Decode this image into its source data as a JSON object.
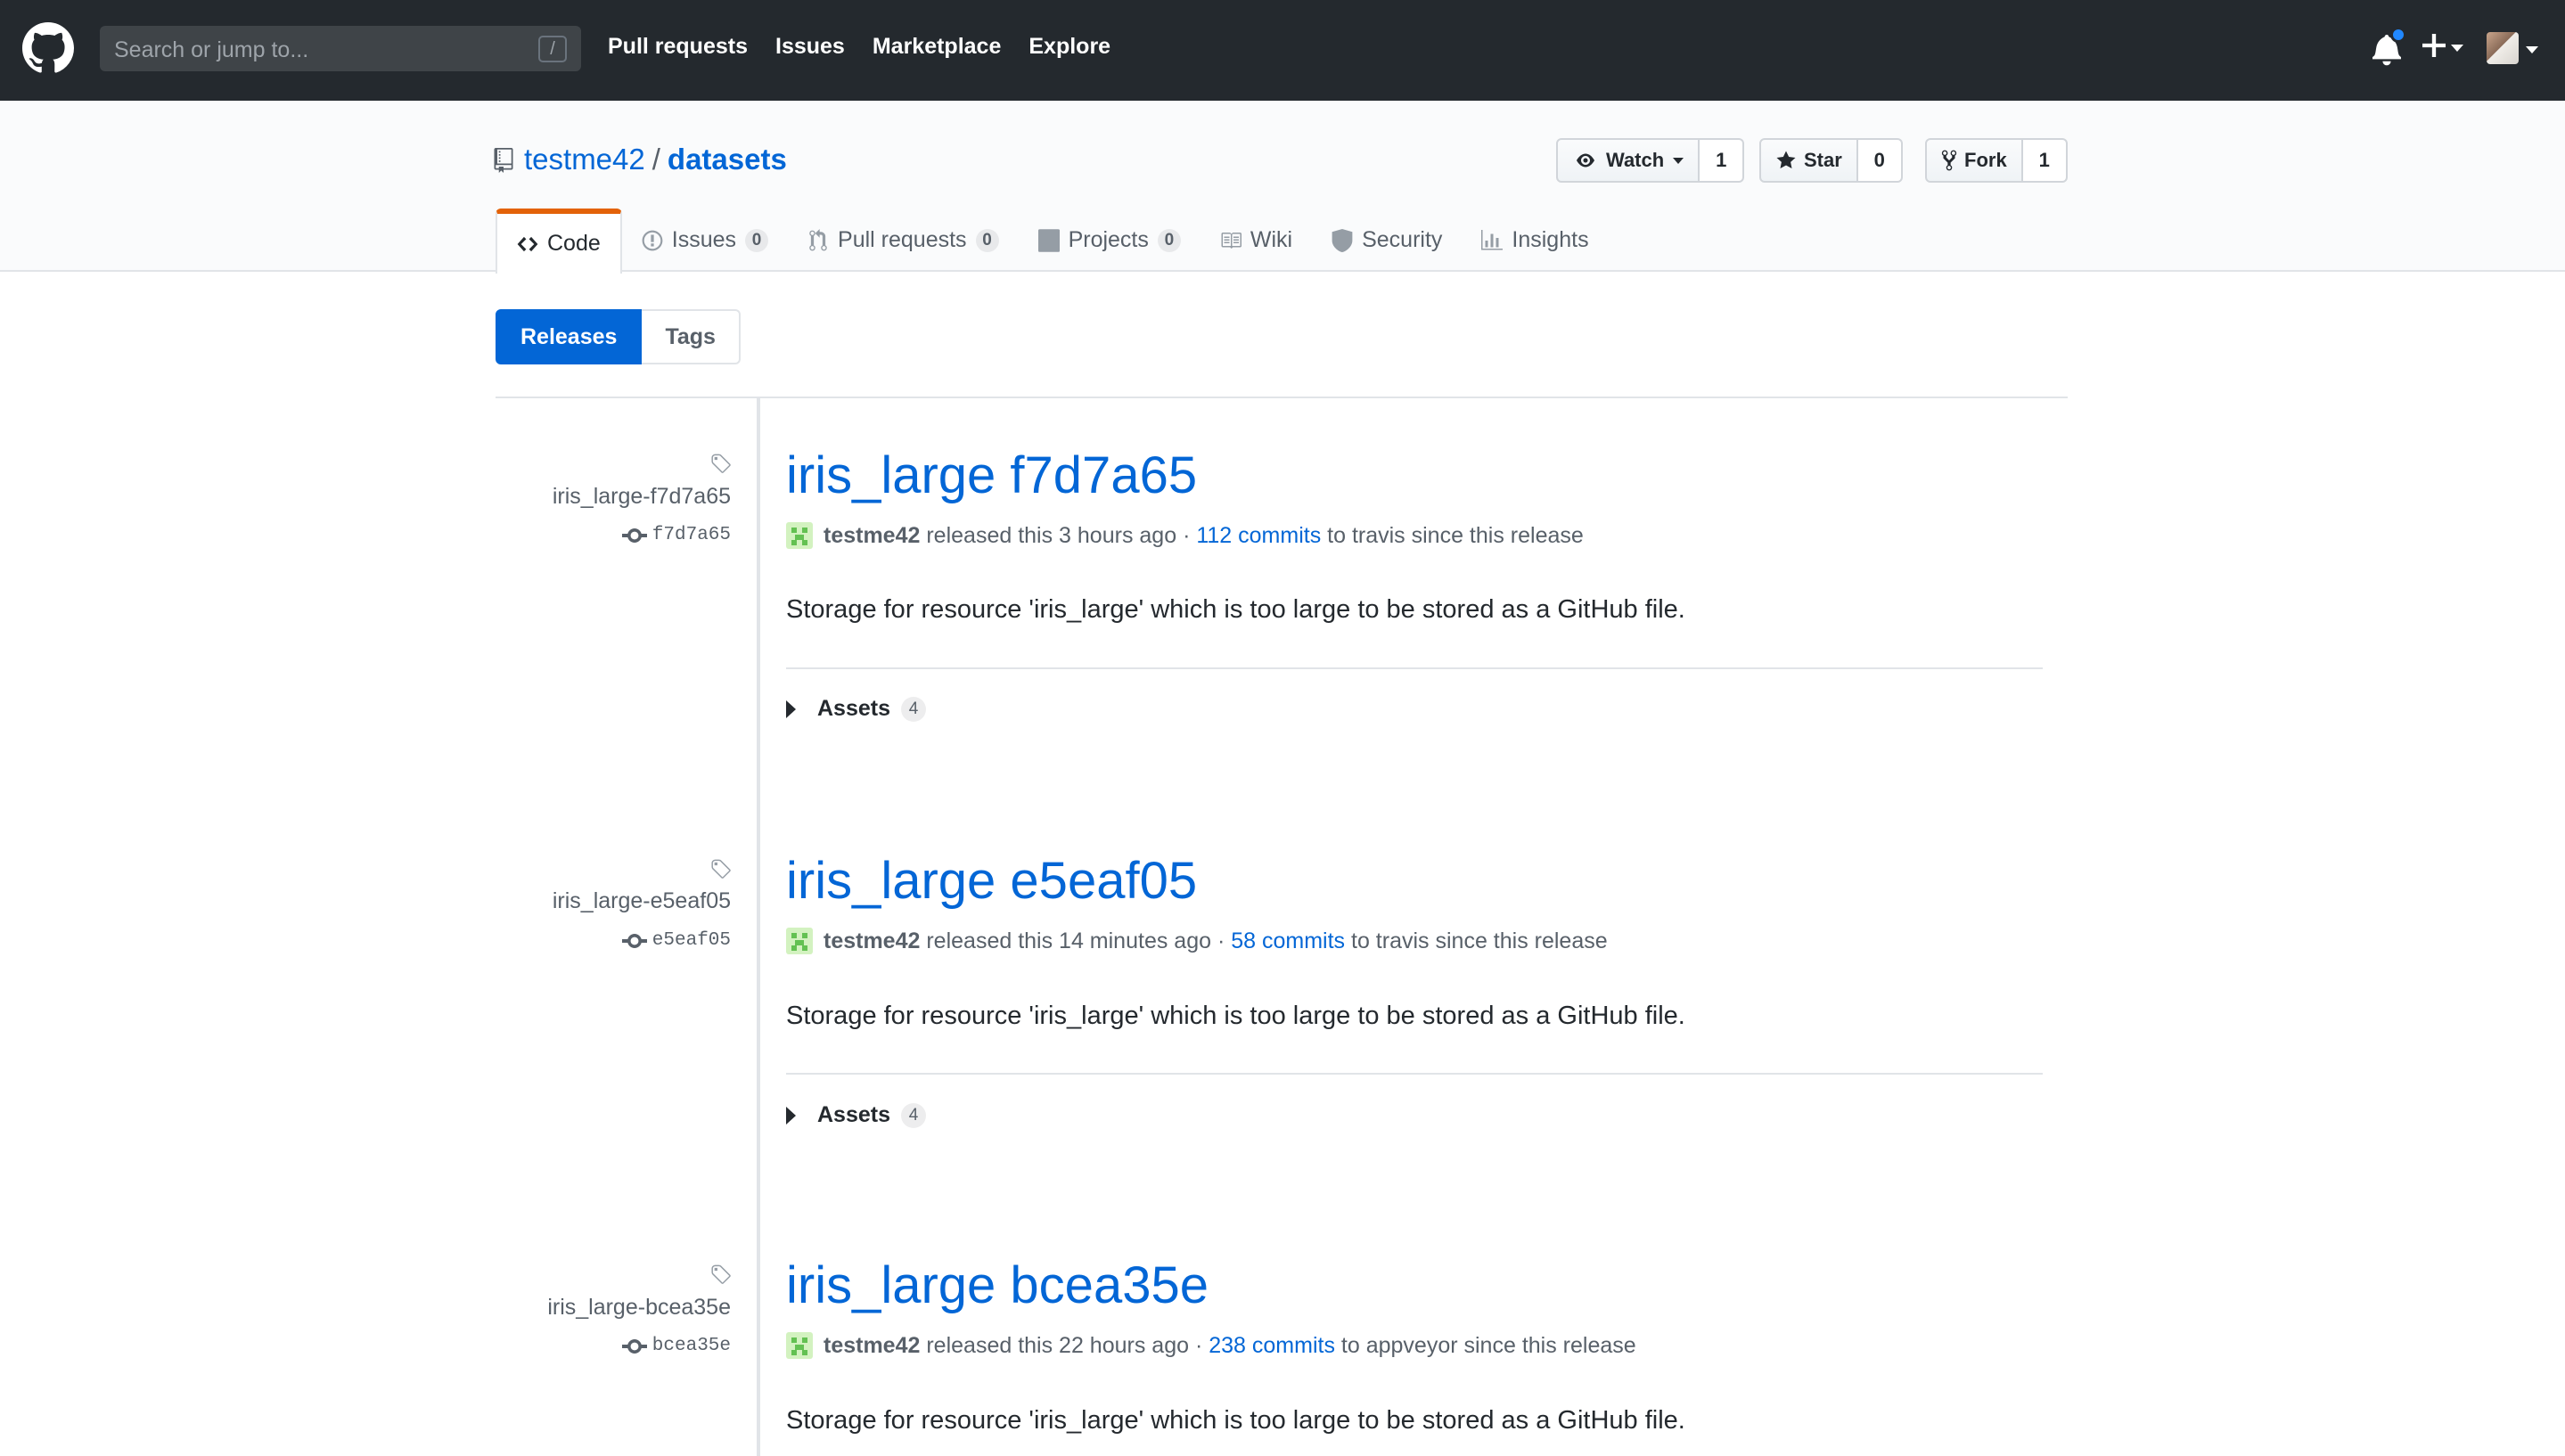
{
  "topbar": {
    "search_placeholder": "Search or jump to...",
    "search_shortcut": "/",
    "nav": [
      "Pull requests",
      "Issues",
      "Marketplace",
      "Explore"
    ]
  },
  "repo": {
    "owner": "testme42",
    "separator": "/",
    "name": "datasets",
    "watch": {
      "label": "Watch",
      "count": "1"
    },
    "star": {
      "label": "Star",
      "count": "0"
    },
    "fork": {
      "label": "Fork",
      "count": "1"
    }
  },
  "tabs": [
    {
      "label": "Code",
      "icon": "code-icon"
    },
    {
      "label": "Issues",
      "count": "0",
      "icon": "issue-opened-icon"
    },
    {
      "label": "Pull requests",
      "count": "0",
      "icon": "git-pull-request-icon"
    },
    {
      "label": "Projects",
      "count": "0",
      "icon": "project-icon"
    },
    {
      "label": "Wiki",
      "icon": "book-icon"
    },
    {
      "label": "Security",
      "icon": "shield-icon"
    },
    {
      "label": "Insights",
      "icon": "graph-icon"
    }
  ],
  "subnav": {
    "releases": "Releases",
    "tags": "Tags"
  },
  "releases": [
    {
      "tag": "iris_large-f7d7a65",
      "sha": "f7d7a65",
      "title": "iris_large f7d7a65",
      "author": "testme42",
      "released_text": "released this 3 hours ago",
      "dot": "·",
      "commits": "112 commits",
      "branch_text": "to travis since this release",
      "body": "Storage for resource 'iris_large' which is too large to be stored as a GitHub file.",
      "assets_label": "Assets",
      "assets_count": "4"
    },
    {
      "tag": "iris_large-e5eaf05",
      "sha": "e5eaf05",
      "title": "iris_large e5eaf05",
      "author": "testme42",
      "released_text": "released this 14 minutes ago",
      "dot": "·",
      "commits": "58 commits",
      "branch_text": "to travis since this release",
      "body": "Storage for resource 'iris_large' which is too large to be stored as a GitHub file.",
      "assets_label": "Assets",
      "assets_count": "4"
    },
    {
      "tag": "iris_large-bcea35e",
      "sha": "bcea35e",
      "title": "iris_large bcea35e",
      "author": "testme42",
      "released_text": "released this 22 hours ago",
      "dot": "·",
      "commits": "238 commits",
      "branch_text": "to appveyor since this release",
      "body": "Storage for resource 'iris_large' which is too large to be stored as a GitHub file."
    }
  ],
  "colors": {
    "header_bg": "#24292e",
    "link": "#0366d6",
    "tab_accent": "#e36209",
    "notification_dot": "#2188ff"
  }
}
